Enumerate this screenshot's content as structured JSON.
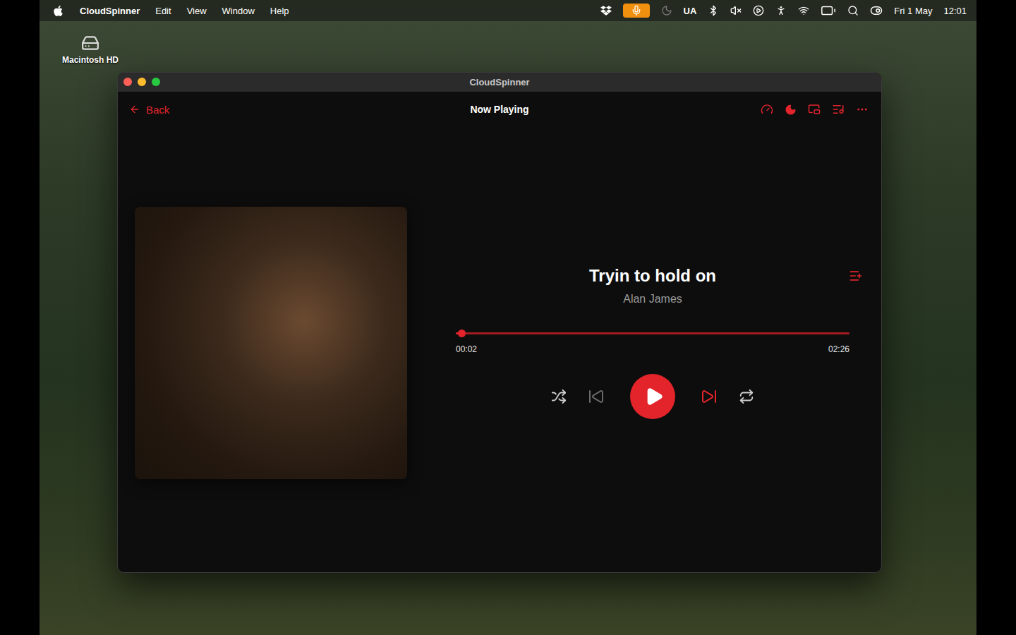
{
  "menu_bar": {
    "app": "CloudSpinner",
    "items": [
      "Edit",
      "View",
      "Window",
      "Help"
    ],
    "mic_active": true,
    "keyboard": "UA",
    "date": "Fri 1 May",
    "time": "12:01"
  },
  "desktop": {
    "icons": [
      {
        "label": "Macintosh HD"
      }
    ]
  },
  "window": {
    "title": "CloudSpinner"
  },
  "toolbar": {
    "back": "Back",
    "title": "Now Playing"
  },
  "track": {
    "title": "Tryin to hold on",
    "artist": "Alan James"
  },
  "progress": {
    "level": 0.014,
    "elapsed": "00:02",
    "duration": "02:26"
  },
  "controls": {
    "shuffle": false,
    "repeat": false,
    "playing": false,
    "previous_disabled": true
  }
}
